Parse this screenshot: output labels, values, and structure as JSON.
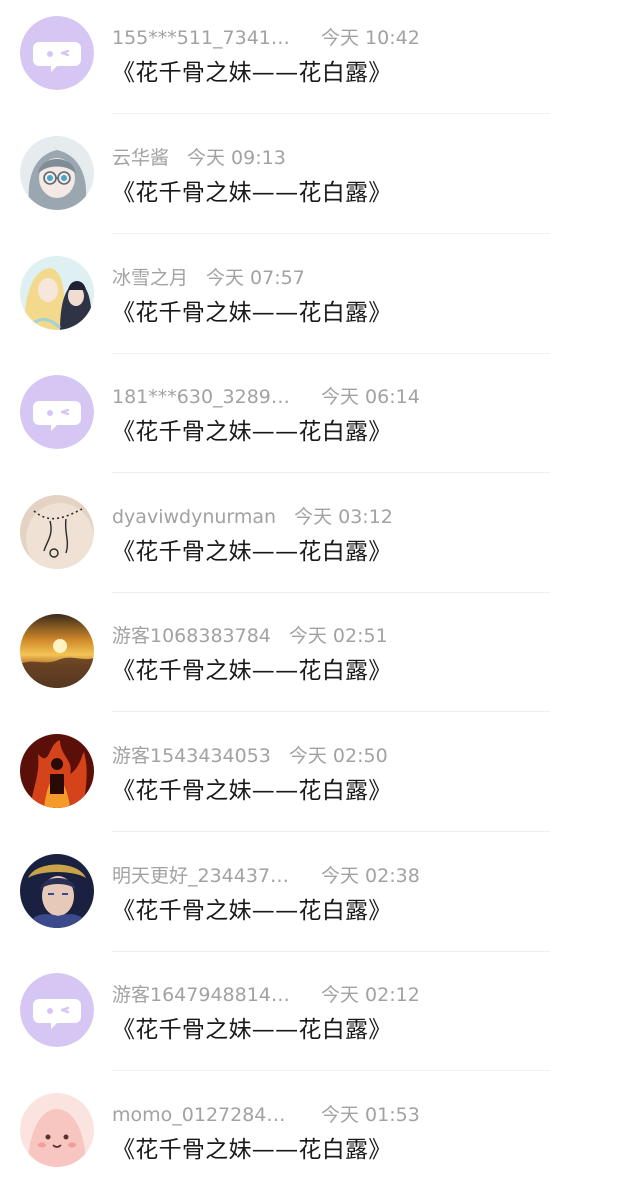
{
  "items": [
    {
      "name": "155***511_73411…",
      "time": "今天 10:42",
      "title": "《花千骨之妹——花白露》",
      "avatar": "default-chat-avatar"
    },
    {
      "name": "云华酱",
      "time": "今天 09:13",
      "title": "《花千骨之妹——花白露》",
      "avatar": "anime-girl-glasses-avatar"
    },
    {
      "name": "冰雪之月",
      "time": "今天 07:57",
      "title": "《花千骨之妹——花白露》",
      "avatar": "anime-couple-avatar"
    },
    {
      "name": "181***630_3289…",
      "time": "今天 06:14",
      "title": "《花千骨之妹——花白露》",
      "avatar": "default-chat-avatar"
    },
    {
      "name": "dyaviwdynurman",
      "time": "今天 03:12",
      "title": "《花千骨之妹——花白露》",
      "avatar": "back-tattoo-avatar"
    },
    {
      "name": "游客1068383784",
      "time": "今天 02:51",
      "title": "《花千骨之妹——花白露》",
      "avatar": "sunset-clouds-avatar"
    },
    {
      "name": "游客1543434053",
      "time": "今天 02:50",
      "title": "《花千骨之妹——花白露》",
      "avatar": "fire-warrior-avatar"
    },
    {
      "name": "明天更好_234437…",
      "time": "今天 02:38",
      "title": "《花千骨之妹——花白露》",
      "avatar": "game-hero-avatar"
    },
    {
      "name": "游客1647948814…",
      "time": "今天 02:12",
      "title": "《花千骨之妹——花白露》",
      "avatar": "default-chat-avatar"
    },
    {
      "name": "momo_0127284…",
      "time": "今天 01:53",
      "title": "《花千骨之妹——花白露》",
      "avatar": "pink-blob-avatar"
    }
  ],
  "colors": {
    "meta_text": "#a2a2a2",
    "title_text": "#1a1a1a",
    "default_avatar_bg": "#d6c6f3",
    "divider": "#efefef"
  }
}
